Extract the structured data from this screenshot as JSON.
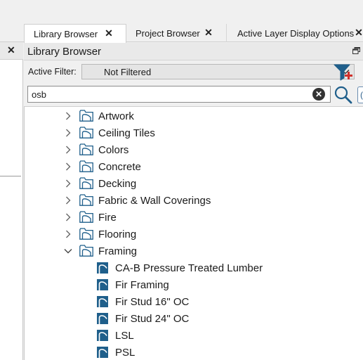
{
  "tabs": [
    {
      "label": "Library Browser",
      "close": "✕",
      "active": true
    },
    {
      "label": "Project Browser",
      "close": "✕",
      "active": false
    },
    {
      "label": "Active Layer Display Options",
      "close": "✕",
      "active": false
    }
  ],
  "left_panel": {
    "close": "✕"
  },
  "panel": {
    "title": "Library Browser",
    "float_icon": "float-window-icon"
  },
  "filter": {
    "label": "Active Filter:",
    "value": "Not Filtered",
    "icon": "add-filter-icon"
  },
  "search": {
    "value": "osb",
    "clear_icon": "clear-icon",
    "search_icon": "search-icon"
  },
  "tree": {
    "folders": [
      {
        "label": "Artwork",
        "expanded": false
      },
      {
        "label": "Ceiling Tiles",
        "expanded": false
      },
      {
        "label": "Colors",
        "expanded": false
      },
      {
        "label": "Concrete",
        "expanded": false
      },
      {
        "label": "Decking",
        "expanded": false
      },
      {
        "label": "Fabric & Wall Coverings",
        "expanded": false
      },
      {
        "label": "Fire",
        "expanded": false
      },
      {
        "label": "Flooring",
        "expanded": false
      },
      {
        "label": "Framing",
        "expanded": true
      }
    ],
    "materials": [
      {
        "label": "CA-B Pressure Treated Lumber"
      },
      {
        "label": "Fir Framing"
      },
      {
        "label": "Fir Stud 16\" OC"
      },
      {
        "label": "Fir Stud 24\" OC"
      },
      {
        "label": "LSL"
      },
      {
        "label": "PSL"
      }
    ]
  },
  "colors": {
    "accent_blue": "#1f5f8b",
    "filter_red": "#d0312d"
  }
}
